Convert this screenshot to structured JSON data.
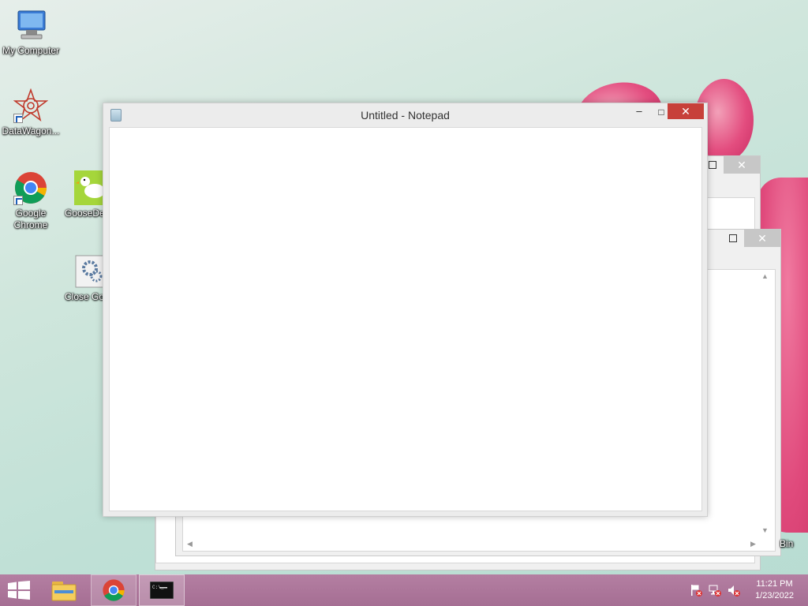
{
  "desktop": {
    "icons": [
      {
        "label": "My Computer",
        "icon": "computer-icon"
      },
      {
        "label": "DataWagon...",
        "icon": "datawagon-icon"
      },
      {
        "label": "Google Chrome",
        "icon": "chrome-icon"
      },
      {
        "label": "GooseDe",
        "icon": "goose-icon"
      },
      {
        "label": "Close Go",
        "icon": "settings-gear-icon"
      },
      {
        "label": "Bin",
        "icon": "recycle-bin-icon"
      }
    ]
  },
  "notepad": {
    "title": "Untitled - Notepad",
    "minimize": "–",
    "maximize": "□",
    "close": "✕",
    "content": ""
  },
  "taskbar": {
    "start": "windows-start-icon",
    "items": [
      "file-explorer-icon",
      "chrome-icon",
      "command-prompt-icon"
    ],
    "tray": [
      "action-center-flag-icon",
      "network-icon",
      "volume-muted-icon"
    ],
    "time": "11:21 PM",
    "date": "1/23/2022"
  },
  "colors": {
    "taskbar": "#a56e93",
    "close_button": "#c7403a"
  }
}
